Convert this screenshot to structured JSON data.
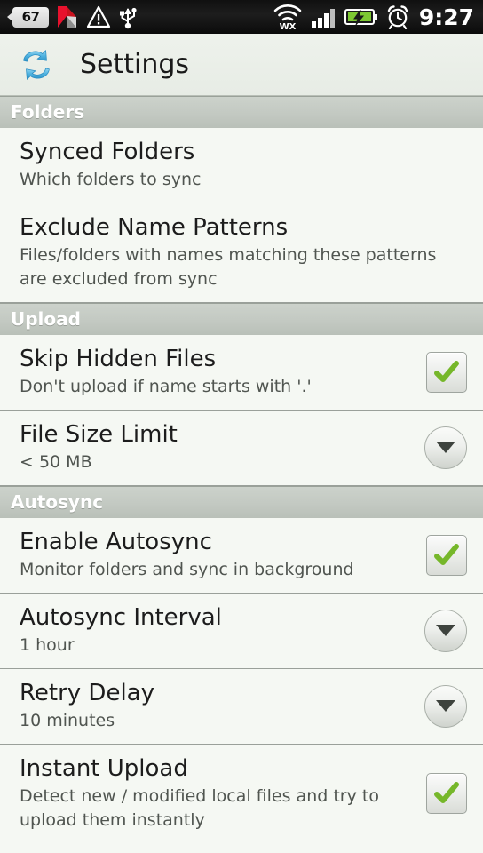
{
  "statusbar": {
    "battery_badge": "67",
    "time": "9:27",
    "left_icons": [
      {
        "name": "battery-percent-badge",
        "label": "67"
      },
      {
        "name": "kaspersky-icon",
        "label": "K"
      },
      {
        "name": "warning-triangle-icon",
        "label": "!"
      },
      {
        "name": "usb-icon",
        "label": "USB"
      }
    ],
    "right_icons": [
      {
        "name": "wifi-wx-icon",
        "label": "WX"
      },
      {
        "name": "signal-bars-icon",
        "label": "signal"
      },
      {
        "name": "battery-charging-icon",
        "label": "charging"
      },
      {
        "name": "alarm-clock-icon",
        "label": "alarm"
      }
    ]
  },
  "titlebar": {
    "icon": "sync-arrows-icon",
    "title": "Settings"
  },
  "colors": {
    "accent": "#4aaede",
    "check_green": "#76b72a",
    "section_bg": "#c5cbc4",
    "list_bg": "#f5f8f3",
    "statusbar_bg": "#101010"
  },
  "sections": [
    {
      "header": "Folders",
      "rows": [
        {
          "title": "Synced Folders",
          "subtitle": "Which folders to sync",
          "widget": "none"
        },
        {
          "title": "Exclude Name Patterns",
          "subtitle": "Files/folders with names matching these patterns are excluded from sync",
          "widget": "none"
        }
      ]
    },
    {
      "header": "Upload",
      "rows": [
        {
          "title": "Skip Hidden Files",
          "subtitle": "Don't upload if name starts with '.'",
          "widget": "checkbox",
          "checked": true
        },
        {
          "title": "File Size Limit",
          "subtitle": "< 50 MB",
          "widget": "dropdown"
        }
      ]
    },
    {
      "header": "Autosync",
      "rows": [
        {
          "title": "Enable Autosync",
          "subtitle": "Monitor folders and sync in background",
          "widget": "checkbox",
          "checked": true
        },
        {
          "title": "Autosync Interval",
          "subtitle": "1 hour",
          "widget": "dropdown"
        },
        {
          "title": "Retry Delay",
          "subtitle": "10 minutes",
          "widget": "dropdown"
        },
        {
          "title": "Instant Upload",
          "subtitle": "Detect new / modified local files and try to upload them instantly",
          "widget": "checkbox",
          "checked": true
        }
      ]
    }
  ]
}
